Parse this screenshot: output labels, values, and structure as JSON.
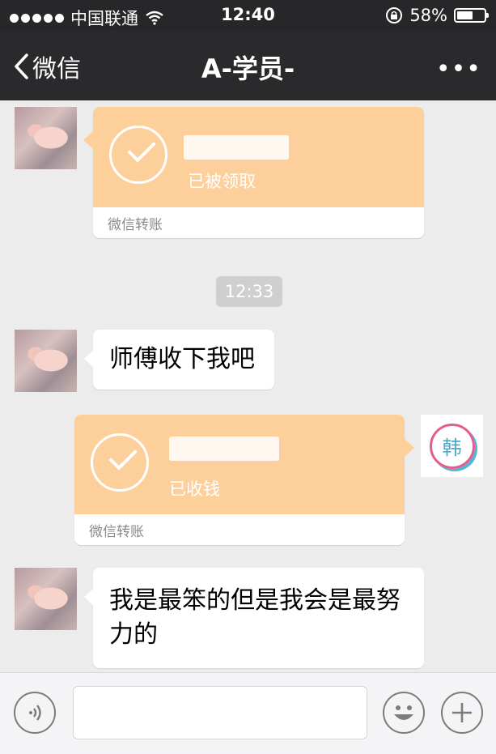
{
  "status_bar": {
    "carrier": "中国联通",
    "time": "12:40",
    "battery_text": "58%",
    "battery_level": 0.58
  },
  "nav": {
    "back_label": "微信",
    "title": "A-学员-",
    "more_label": "•••"
  },
  "messages": {
    "transfer_1": {
      "status": "已被领取",
      "footer": "微信转账"
    },
    "timestamp": "12:33",
    "text_1": "师傅收下我吧",
    "transfer_2": {
      "status": "已收钱",
      "footer": "微信转账"
    },
    "text_2": "我是最笨的但是我会是最努力的"
  },
  "avatars": {
    "self_badge": "韩"
  },
  "colors": {
    "transfer_bg": "#fdd09b",
    "nav_bg": "#2a2a2d",
    "chat_bg": "#ececec"
  },
  "icons": {
    "voice": "voice-icon",
    "emoji": "emoji-icon",
    "plus": "plus-icon"
  }
}
